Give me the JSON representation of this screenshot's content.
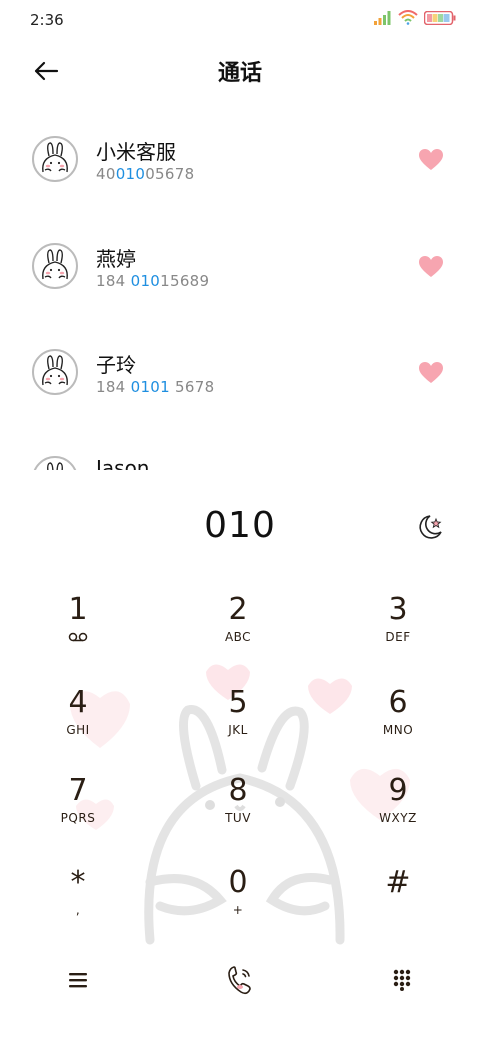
{
  "status_bar": {
    "time": "2:36"
  },
  "header": {
    "title": "通话"
  },
  "contacts": [
    {
      "name": "小米客服",
      "number_pre": "40",
      "number_hl": "010",
      "number_post": "05678"
    },
    {
      "name": "燕婷",
      "number_pre": "184 ",
      "number_hl": "010",
      "number_post": "15689"
    },
    {
      "name": "子玲",
      "number_pre": "184 ",
      "number_hl": "0101",
      "number_post": " 5678"
    },
    {
      "name": "Jason",
      "number_pre": "",
      "number_hl": "",
      "number_post": ""
    }
  ],
  "dial": {
    "input": "010"
  },
  "keypad": [
    {
      "digit": "1",
      "letters": ""
    },
    {
      "digit": "2",
      "letters": "ABC"
    },
    {
      "digit": "3",
      "letters": "DEF"
    },
    {
      "digit": "4",
      "letters": "GHI"
    },
    {
      "digit": "5",
      "letters": "JKL"
    },
    {
      "digit": "6",
      "letters": "MNO"
    },
    {
      "digit": "7",
      "letters": "PQRS"
    },
    {
      "digit": "8",
      "letters": "TUV"
    },
    {
      "digit": "9",
      "letters": "WXYZ"
    },
    {
      "digit": "*",
      "letters": ","
    },
    {
      "digit": "0",
      "letters": "+"
    },
    {
      "digit": "#",
      "letters": ""
    }
  ],
  "icons": {
    "back": "arrow-left-icon",
    "favorite": "heart-icon",
    "theme": "moon-star-icon",
    "voicemail": "voicemail-icon",
    "menu": "menu-icon",
    "call": "phone-call-icon",
    "keypad_toggle": "dialpad-icon"
  },
  "colors": {
    "highlight": "#1f8fe0",
    "heart": "#f7a5b0"
  }
}
